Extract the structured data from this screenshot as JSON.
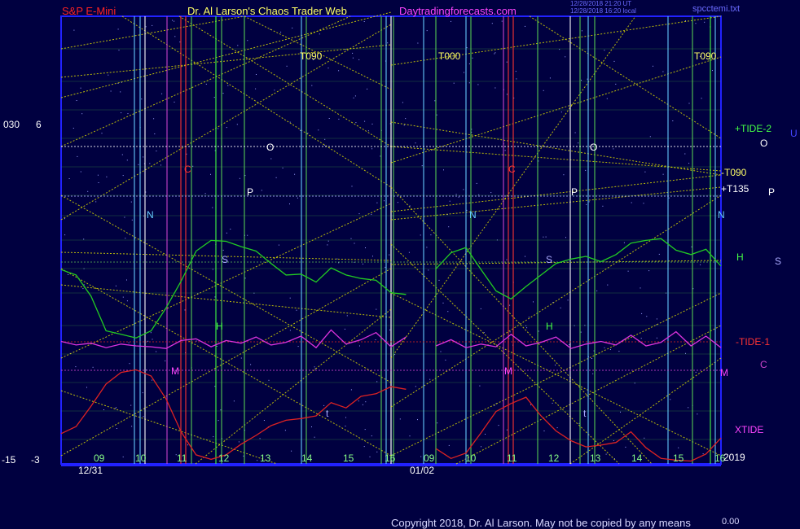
{
  "header": {
    "instrument": "S&P E-Mini",
    "author": "Dr. Al Larson's Chaos Trader Web",
    "site": "Daytradingforecasts.com",
    "stamp_line1": "12/28/2018 21:20 UT",
    "stamp_line2": "12/28/2018 16:20 local",
    "file": "spcctemi.txt"
  },
  "footer": {
    "copyright": "Copyright 2018, Dr. Al Larson. May not be copied by any means",
    "value": "0.00"
  },
  "left_axis": {
    "left_top": "030",
    "left_top2": "6",
    "left_bot": "-15",
    "left_bot2": "-3"
  },
  "chart_data": {
    "type": "line",
    "x": {
      "days": [
        "12/31",
        "01/02"
      ],
      "hour_ticks": [
        "09",
        "10",
        "11",
        "12",
        "13",
        "14",
        "15",
        "16",
        "09",
        "10",
        "11",
        "12",
        "13",
        "14",
        "15",
        "16"
      ]
    },
    "ylim_left": [
      -15,
      30
    ],
    "y_tick_labels": [
      "030",
      "6",
      "-15",
      "-3"
    ],
    "right_labels": [
      "+TIDE-2",
      "-T090",
      "+T135",
      "H",
      "-TIDE-1",
      "M",
      "XTIDE",
      "2019"
    ],
    "right_letters": [
      "O",
      "P",
      "S",
      "C",
      "U"
    ],
    "band_labels": [
      "T090",
      "T000",
      "T090"
    ],
    "line_letters": [
      "N",
      "C",
      "O",
      "P",
      "S",
      "H",
      "M",
      "t"
    ],
    "series": [
      {
        "name": "+TIDE-2",
        "color": "#22cc22",
        "values": [
          6.0,
          5.4,
          3.0,
          -0.9,
          -1.3,
          -1.7,
          -0.9,
          1.7,
          4.7,
          8.1,
          9.3,
          9.2,
          8.6,
          8.1,
          6.7,
          5.4,
          5.5,
          4.6,
          6.2,
          5.4,
          5.0,
          4.8,
          3.4,
          3.2,
          null,
          6.1,
          7.9,
          8.5,
          6.0,
          3.6,
          2.7,
          4.1,
          5.4,
          6.7,
          7.2,
          7.5,
          6.9,
          7.7,
          9.0,
          9.3,
          9.5,
          8.2,
          7.7,
          8.3,
          6.4
        ]
      },
      {
        "name": "-TIDE-1",
        "color": "#dd2222",
        "values": [
          -12.5,
          -11.7,
          -9.4,
          -6.9,
          -5.6,
          -5.3,
          -6.0,
          -8.6,
          -12.3,
          -14.9,
          -15.4,
          -14.9,
          -13.7,
          -12.7,
          -11.6,
          -11.0,
          -10.8,
          -10.5,
          -9.0,
          -9.6,
          -8.3,
          -8.0,
          -7.2,
          -7.5,
          null,
          -14.2,
          -15.3,
          -14.7,
          -12.4,
          -10.0,
          -9.1,
          -8.4,
          -10.5,
          -12.2,
          -13.3,
          -14.0,
          -13.8,
          -13.5,
          -12.3,
          -14.1,
          -15.3,
          -15.5,
          -15.6,
          -14.8,
          -13.0
        ]
      },
      {
        "name": "XTIDE",
        "color": "#dd33dd",
        "values": [
          -2.1,
          -2.5,
          -2.3,
          -2.8,
          -2.4,
          -2.6,
          -2.7,
          -2.9,
          -2.0,
          -1.8,
          -2.7,
          -2.0,
          -2.3,
          -1.6,
          -2.5,
          -2.2,
          -1.5,
          -2.8,
          -0.8,
          -2.4,
          -1.9,
          -1.1,
          -2.7,
          -1.6,
          null,
          -2.6,
          -1.9,
          -2.8,
          -2.4,
          -2.7,
          -1.3,
          -2.6,
          -2.2,
          -1.6,
          -2.9,
          -2.4,
          -2.1,
          -2.5,
          -1.4,
          -2.6,
          -2.2,
          -1.0,
          -2.6,
          -1.5,
          -2.8
        ]
      }
    ],
    "reference_lines": [
      {
        "label": "+TIDE-2",
        "color": "#ffffff"
      },
      {
        "label": "+T135",
        "color": "#aaaaff"
      },
      {
        "label": "H",
        "color": "#55aa55"
      },
      {
        "label": "-TIDE-1",
        "color": "#cc2222"
      },
      {
        "label": "M",
        "color": "#cc44cc"
      }
    ],
    "colors": {
      "background": "#000040",
      "grid": "#44aa44",
      "diagonals": "#dddd00",
      "border": "#2222ff"
    }
  }
}
